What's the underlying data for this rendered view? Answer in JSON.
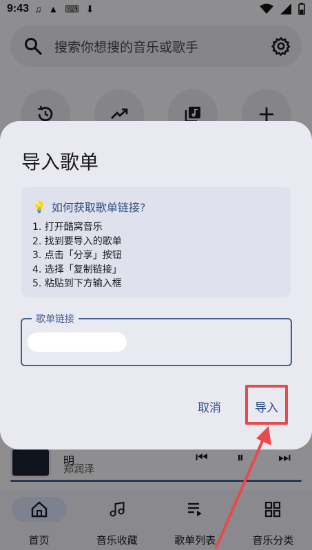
{
  "status_bar": {
    "time": "9:43"
  },
  "search": {
    "placeholder": "搜索你想搜的音乐或歌手"
  },
  "player": {
    "title": "明",
    "artist": "郑润泽"
  },
  "nav": {
    "items": [
      {
        "label": "首页",
        "icon": "home-icon",
        "active": true
      },
      {
        "label": "音乐收藏",
        "icon": "music-note-icon",
        "active": false
      },
      {
        "label": "歌单列表",
        "icon": "playlist-icon",
        "active": false
      },
      {
        "label": "音乐分类",
        "icon": "grid-icon",
        "active": false
      }
    ]
  },
  "dialog": {
    "title": "导入歌单",
    "hint": {
      "title": "如何获取歌单链接?",
      "steps": [
        "1. 打开酷窝音乐",
        "2. 找到要导入的歌单",
        "3. 点击「分享」按钮",
        "4. 选择「复制链接」",
        "5. 粘贴到下方输入框"
      ]
    },
    "field": {
      "label": "歌单链接",
      "value": ""
    },
    "cancel_label": "取消",
    "import_label": "导入"
  },
  "colors": {
    "accent": "#46608f",
    "highlight": "#e9494a",
    "dialog_bg": "#e9e9f1"
  }
}
